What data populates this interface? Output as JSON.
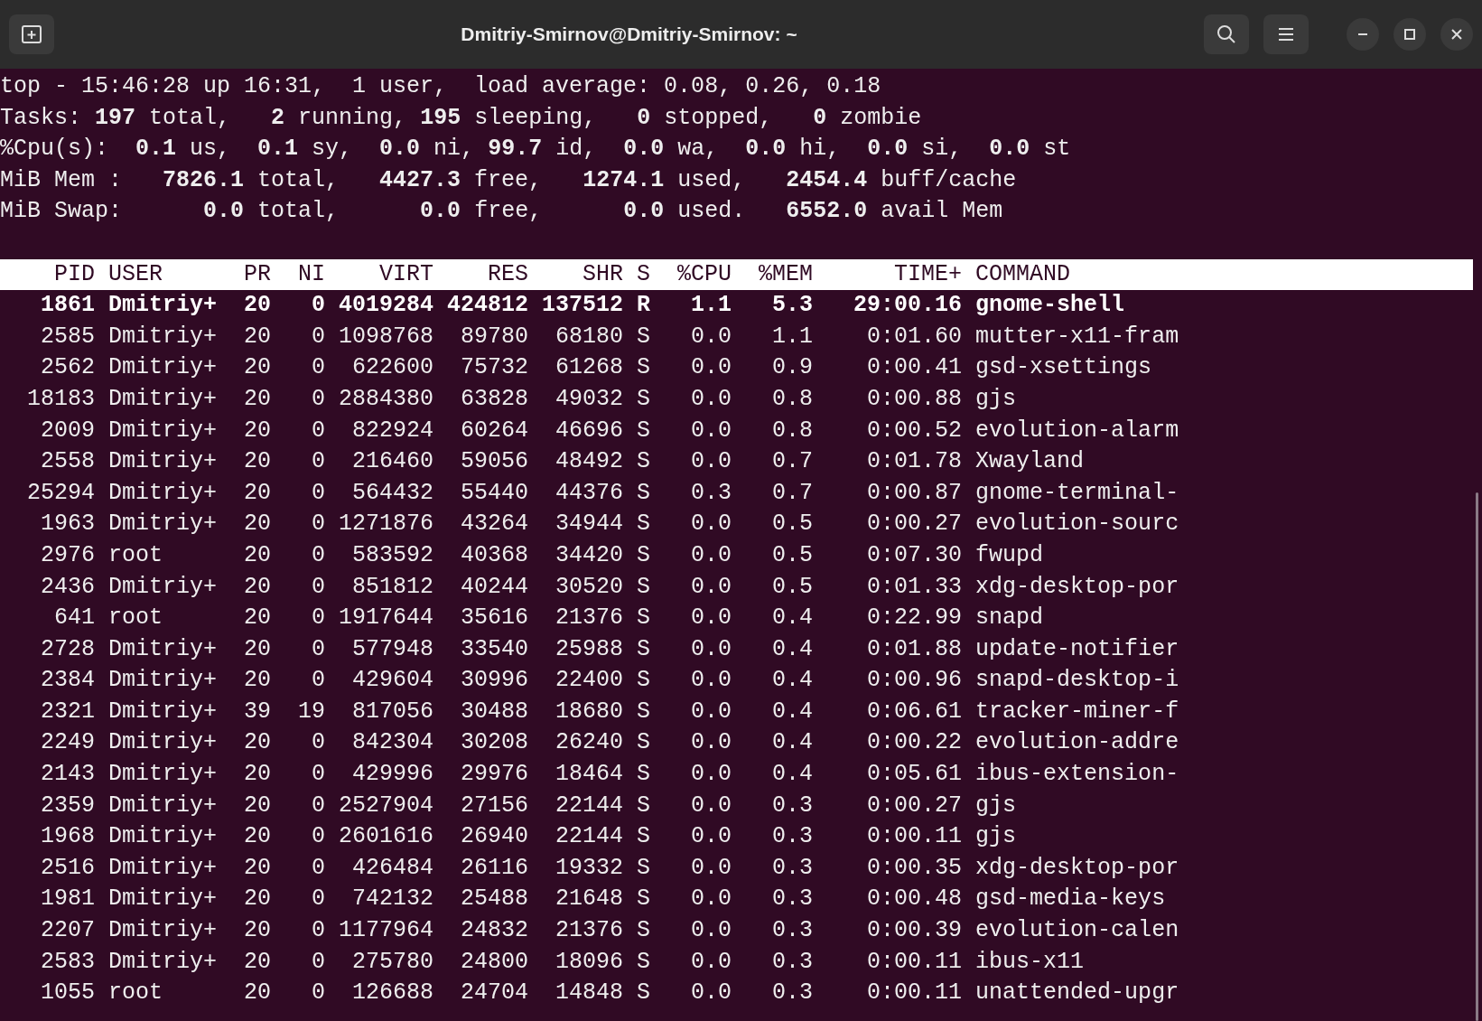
{
  "window": {
    "title": "Dmitriy-Smirnov@Dmitriy-Smirnov: ~"
  },
  "summary": [
    "top - 15:46:28 up 16:31,  1 user,  load average: 0.08, 0.26, 0.18",
    "Tasks: **197** total,   **2** running, **195** sleeping,   **0** stopped,   **0** zombie",
    "%Cpu(s):  **0.1** us,  **0.1** sy,  **0.0** ni, **99.7** id,  **0.0** wa,  **0.0** hi,  **0.0** si,  **0.0** st",
    "MiB Mem :   **7826.1** total,   **4427.3** free,   **1274.1** used,   **2454.4** buff/cache",
    "MiB Swap:      **0.0** total,      **0.0** free,      **0.0** used.   **6552.0** avail Mem"
  ],
  "table": {
    "columns": [
      "PID",
      "USER",
      "PR",
      "NI",
      "VIRT",
      "RES",
      "SHR",
      "S",
      "%CPU",
      "%MEM",
      "TIME+",
      "COMMAND"
    ],
    "rows": [
      {
        "bold": true,
        "cells": [
          "1861",
          "Dmitriy+",
          "20",
          "0",
          "4019284",
          "424812",
          "137512",
          "R",
          "1.1",
          "5.3",
          "29:00.16",
          "gnome-shell"
        ]
      },
      {
        "bold": false,
        "cells": [
          "2585",
          "Dmitriy+",
          "20",
          "0",
          "1098768",
          "89780",
          "68180",
          "S",
          "0.0",
          "1.1",
          "0:01.60",
          "mutter-x11-fram"
        ]
      },
      {
        "bold": false,
        "cells": [
          "2562",
          "Dmitriy+",
          "20",
          "0",
          "622600",
          "75732",
          "61268",
          "S",
          "0.0",
          "0.9",
          "0:00.41",
          "gsd-xsettings"
        ]
      },
      {
        "bold": false,
        "cells": [
          "18183",
          "Dmitriy+",
          "20",
          "0",
          "2884380",
          "63828",
          "49032",
          "S",
          "0.0",
          "0.8",
          "0:00.88",
          "gjs"
        ]
      },
      {
        "bold": false,
        "cells": [
          "2009",
          "Dmitriy+",
          "20",
          "0",
          "822924",
          "60264",
          "46696",
          "S",
          "0.0",
          "0.8",
          "0:00.52",
          "evolution-alarm"
        ]
      },
      {
        "bold": false,
        "cells": [
          "2558",
          "Dmitriy+",
          "20",
          "0",
          "216460",
          "59056",
          "48492",
          "S",
          "0.0",
          "0.7",
          "0:01.78",
          "Xwayland"
        ]
      },
      {
        "bold": false,
        "cells": [
          "25294",
          "Dmitriy+",
          "20",
          "0",
          "564432",
          "55440",
          "44376",
          "S",
          "0.3",
          "0.7",
          "0:00.87",
          "gnome-terminal-"
        ]
      },
      {
        "bold": false,
        "cells": [
          "1963",
          "Dmitriy+",
          "20",
          "0",
          "1271876",
          "43264",
          "34944",
          "S",
          "0.0",
          "0.5",
          "0:00.27",
          "evolution-sourc"
        ]
      },
      {
        "bold": false,
        "cells": [
          "2976",
          "root",
          "20",
          "0",
          "583592",
          "40368",
          "34420",
          "S",
          "0.0",
          "0.5",
          "0:07.30",
          "fwupd"
        ]
      },
      {
        "bold": false,
        "cells": [
          "2436",
          "Dmitriy+",
          "20",
          "0",
          "851812",
          "40244",
          "30520",
          "S",
          "0.0",
          "0.5",
          "0:01.33",
          "xdg-desktop-por"
        ]
      },
      {
        "bold": false,
        "cells": [
          "641",
          "root",
          "20",
          "0",
          "1917644",
          "35616",
          "21376",
          "S",
          "0.0",
          "0.4",
          "0:22.99",
          "snapd"
        ]
      },
      {
        "bold": false,
        "cells": [
          "2728",
          "Dmitriy+",
          "20",
          "0",
          "577948",
          "33540",
          "25988",
          "S",
          "0.0",
          "0.4",
          "0:01.88",
          "update-notifier"
        ]
      },
      {
        "bold": false,
        "cells": [
          "2384",
          "Dmitriy+",
          "20",
          "0",
          "429604",
          "30996",
          "22400",
          "S",
          "0.0",
          "0.4",
          "0:00.96",
          "snapd-desktop-i"
        ]
      },
      {
        "bold": false,
        "cells": [
          "2321",
          "Dmitriy+",
          "39",
          "19",
          "817056",
          "30488",
          "18680",
          "S",
          "0.0",
          "0.4",
          "0:06.61",
          "tracker-miner-f"
        ]
      },
      {
        "bold": false,
        "cells": [
          "2249",
          "Dmitriy+",
          "20",
          "0",
          "842304",
          "30208",
          "26240",
          "S",
          "0.0",
          "0.4",
          "0:00.22",
          "evolution-addre"
        ]
      },
      {
        "bold": false,
        "cells": [
          "2143",
          "Dmitriy+",
          "20",
          "0",
          "429996",
          "29976",
          "18464",
          "S",
          "0.0",
          "0.4",
          "0:05.61",
          "ibus-extension-"
        ]
      },
      {
        "bold": false,
        "cells": [
          "2359",
          "Dmitriy+",
          "20",
          "0",
          "2527904",
          "27156",
          "22144",
          "S",
          "0.0",
          "0.3",
          "0:00.27",
          "gjs"
        ]
      },
      {
        "bold": false,
        "cells": [
          "1968",
          "Dmitriy+",
          "20",
          "0",
          "2601616",
          "26940",
          "22144",
          "S",
          "0.0",
          "0.3",
          "0:00.11",
          "gjs"
        ]
      },
      {
        "bold": false,
        "cells": [
          "2516",
          "Dmitriy+",
          "20",
          "0",
          "426484",
          "26116",
          "19332",
          "S",
          "0.0",
          "0.3",
          "0:00.35",
          "xdg-desktop-por"
        ]
      },
      {
        "bold": false,
        "cells": [
          "1981",
          "Dmitriy+",
          "20",
          "0",
          "742132",
          "25488",
          "21648",
          "S",
          "0.0",
          "0.3",
          "0:00.48",
          "gsd-media-keys"
        ]
      },
      {
        "bold": false,
        "cells": [
          "2207",
          "Dmitriy+",
          "20",
          "0",
          "1177964",
          "24832",
          "21376",
          "S",
          "0.0",
          "0.3",
          "0:00.39",
          "evolution-calen"
        ]
      },
      {
        "bold": false,
        "cells": [
          "2583",
          "Dmitriy+",
          "20",
          "0",
          "275780",
          "24800",
          "18096",
          "S",
          "0.0",
          "0.3",
          "0:00.11",
          "ibus-x11"
        ]
      },
      {
        "bold": false,
        "cells": [
          "1055",
          "root",
          "20",
          "0",
          "126688",
          "24704",
          "14848",
          "S",
          "0.0",
          "0.3",
          "0:00.11",
          "unattended-upgr"
        ]
      }
    ]
  }
}
